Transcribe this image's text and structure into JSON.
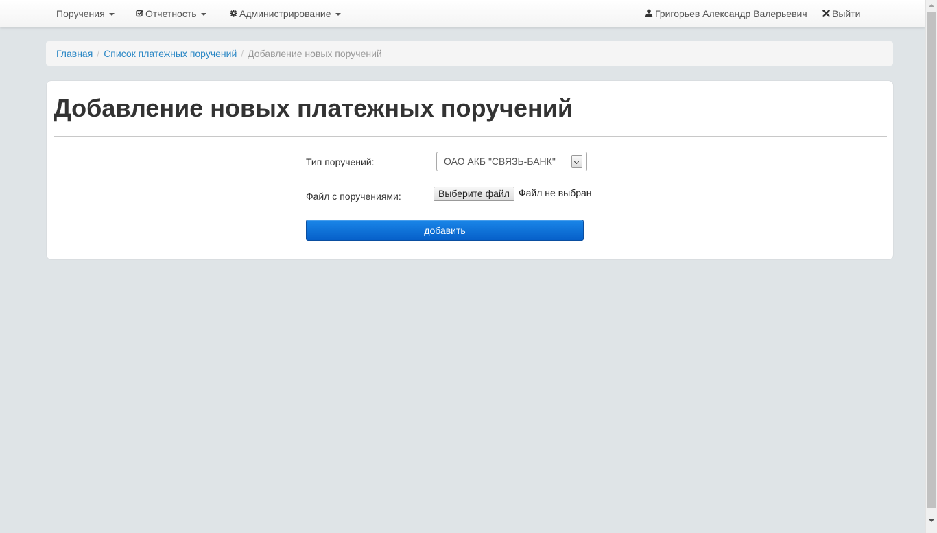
{
  "navbar": {
    "menu": [
      {
        "label": "Поручения",
        "icon": "none"
      },
      {
        "label": "Отчетность",
        "icon": "check-square-icon"
      },
      {
        "label": "Администрирование",
        "icon": "gear-icon"
      }
    ],
    "user": {
      "label": "Григорьев Александр Валерьевич",
      "icon": "user-icon"
    },
    "logout": {
      "label": "Выйти",
      "icon": "close-icon"
    }
  },
  "breadcrumb": {
    "home": "Главная",
    "list": "Список платежных поручений",
    "current": "Добавление новых поручений",
    "separator": "/"
  },
  "page": {
    "title": "Добавление новых платежных поручений"
  },
  "form": {
    "type_label": "Тип поручений:",
    "type_selected": "ОАО АКБ \"СВЯЗЬ-БАНК\"",
    "file_label": "Файл с поручениями:",
    "file_button": "Выберите файл",
    "file_status": "Файл не выбран",
    "submit_label": "добавить"
  },
  "colors": {
    "accent": "#0a6fd6",
    "link": "#2a87c5",
    "background": "#dfe4e7"
  }
}
